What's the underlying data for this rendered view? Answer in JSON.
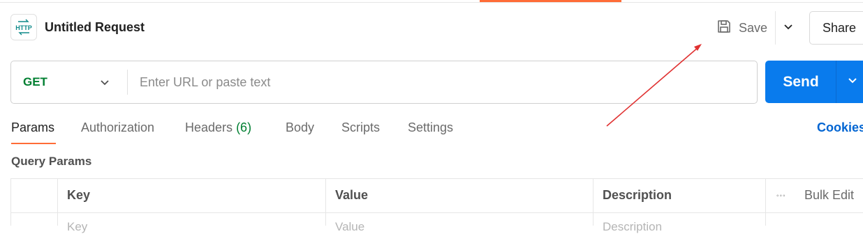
{
  "header": {
    "icon_text": "HTTP",
    "title": "Untitled Request",
    "save_label": "Save",
    "share_label": "Share"
  },
  "request": {
    "method": "GET",
    "url_value": "",
    "url_placeholder": "Enter URL or paste text",
    "send_label": "Send"
  },
  "tabs": [
    {
      "label": "Params",
      "count": ""
    },
    {
      "label": "Authorization",
      "count": ""
    },
    {
      "label": "Headers",
      "count": "(6)"
    },
    {
      "label": "Body",
      "count": ""
    },
    {
      "label": "Scripts",
      "count": ""
    },
    {
      "label": "Settings",
      "count": ""
    }
  ],
  "active_tab": "Params",
  "cookies_label": "Cookies",
  "query_params": {
    "title": "Query Params",
    "columns": [
      "Key",
      "Value",
      "Description"
    ],
    "bulk_edit_label": "Bulk Edit",
    "more_icon": "◦◦◦",
    "placeholders": [
      "Key",
      "Value",
      "Description"
    ]
  },
  "colors": {
    "accent": "#ff6c37",
    "send": "#097bed",
    "method_get": "#007f31",
    "link": "#0265d2",
    "annotation": "#e03131"
  },
  "icons": [
    "http-icon",
    "save-icon",
    "chevron-down-icon",
    "more-icon"
  ]
}
